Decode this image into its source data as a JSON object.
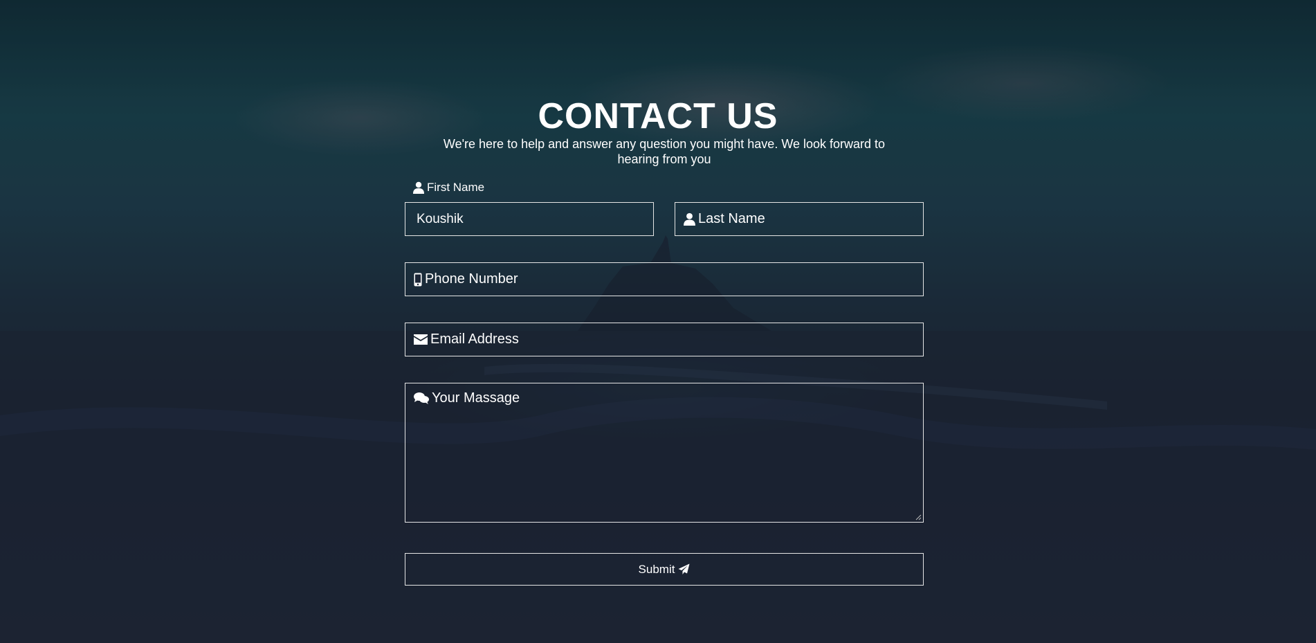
{
  "header": {
    "title": "CONTACT US",
    "subtitle": "We're here to help and answer any question you might have. We look forward to hearing from you"
  },
  "form": {
    "first_name_label": "First Name",
    "first_name_value": "Koushik",
    "last_name_placeholder": "Last Name",
    "phone_placeholder": "Phone Number",
    "email_placeholder": "Email Address",
    "message_placeholder": "Your Massage",
    "submit_label": "Submit"
  },
  "icons": {
    "user": "user-icon",
    "phone": "mobile-phone-icon",
    "email": "envelope-icon",
    "message": "comments-icon",
    "submit": "paper-plane-icon"
  },
  "colors": {
    "text": "#ffffff",
    "border": "#e6e6e6",
    "background_dark": "#1b2434"
  }
}
